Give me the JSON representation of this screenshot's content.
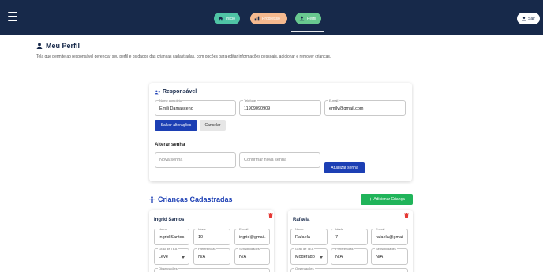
{
  "nav": {
    "items": [
      {
        "label": "Início",
        "icon": "home-icon",
        "color": "#4fc4a5"
      },
      {
        "label": "Progresso",
        "icon": "chart-icon",
        "color": "#f5b98f"
      },
      {
        "label": "Perfil",
        "icon": "user-icon",
        "color": "#68c88f"
      }
    ],
    "logout_label": "Sair"
  },
  "page": {
    "title": "Meu Perfil",
    "description": "Tela que permite ao responsável gerenciar seu perfil e os dados das crianças cadastradas, com opções para editar informações pessoais, adicionar e remover crianças."
  },
  "responsavel": {
    "title": "Responsável",
    "fields": {
      "nome": {
        "label": "Nome completo",
        "value": "Emili Damasceno"
      },
      "telefone": {
        "label": "Telefone",
        "value": "11909090909"
      },
      "email": {
        "label": "E-mail",
        "value": "emily@gmail.com"
      }
    },
    "save_label": "Salvar alterações",
    "cancel_label": "Cancelar",
    "password": {
      "title": "Alterar senha",
      "new_placeholder": "Nova senha",
      "confirm_placeholder": "Confirmar nova senha",
      "update_label": "Atualizar senha"
    }
  },
  "criancas": {
    "title": "Crianças Cadastradas",
    "add_label": "Adicionar Criança",
    "labels": {
      "nome": "Nome",
      "idade": "Idade",
      "email": "E-mail",
      "grau": "Grau de TEA",
      "preferencias": "Preferências",
      "sensibilidades": "Sensibilidades",
      "observacoes": "Observações"
    },
    "items": [
      {
        "name": "Ingrid Santos",
        "nome": "Ingrid Santos",
        "idade": "10",
        "email": "ingrid@gmail.",
        "grau": "Leve",
        "preferencias": "N/A",
        "sensibilidades": "N/A"
      },
      {
        "name": "Rafaela",
        "nome": "Rafaela",
        "idade": "7",
        "email": "rafaela@gmai",
        "grau": "Moderado",
        "preferencias": "N/A",
        "sensibilidades": "N/A"
      }
    ]
  },
  "colors": {
    "topbar": "#17294a",
    "primary": "#1c3fb4",
    "success": "#20b45a",
    "danger": "#e53935"
  }
}
